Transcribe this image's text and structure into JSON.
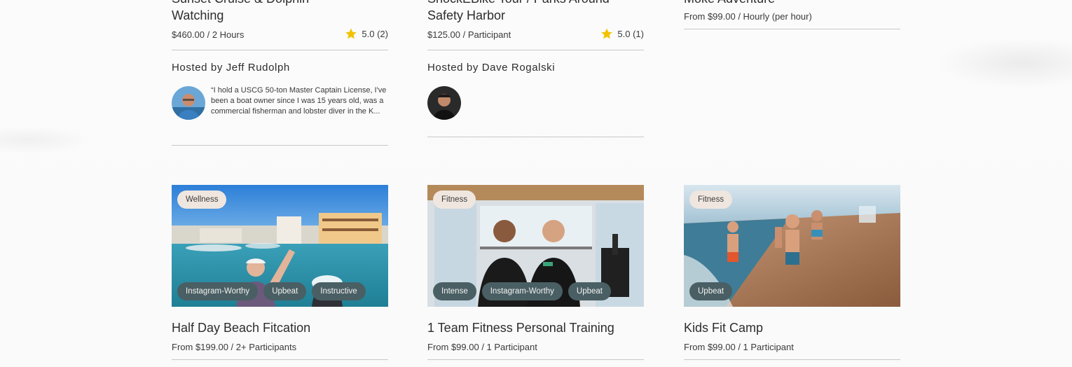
{
  "top_cards": [
    {
      "title_line1": "Sunset Cruise & Dolphin",
      "title_line2": "Watching",
      "price": "$460.00 / 2 Hours",
      "rating": "5.0 (2)",
      "hosted_by": "Hosted by Jeff Rudolph",
      "quote": "“I hold a USCG 50-ton Master Captain License, I've been a boat owner since I was 15 years old, was a commercial fisherman and lobster diver in the K..."
    },
    {
      "title_line1": "ShockEBike Tour / Parks Around",
      "title_line2": "Safety Harbor",
      "price": "$125.00 / Participant",
      "rating": "5.0 (1)",
      "hosted_by": "Hosted by Dave Rogalski"
    },
    {
      "title_line1": "Moke Adventure",
      "price": "From $99.00 / Hourly (per hour)"
    }
  ],
  "bottom_cards": [
    {
      "category": "Wellness",
      "tags": [
        "Instagram-Worthy",
        "Upbeat",
        "Instructive"
      ],
      "title": "Half Day Beach Fitcation",
      "price": "From $199.00 / 2+ Participants"
    },
    {
      "category": "Fitness",
      "tags": [
        "Intense",
        "Instagram-Worthy",
        "Upbeat"
      ],
      "title": "1 Team Fitness Personal Training",
      "price": "From $99.00 / 1 Participant"
    },
    {
      "category": "Fitness",
      "tags": [
        "Upbeat"
      ],
      "title": "Kids Fit Camp",
      "price": "From $99.00 / 1 Participant"
    }
  ],
  "colors": {
    "star": "#f2c200",
    "tag_bg": "#4a5f64",
    "category_bg": "#efe6df"
  }
}
